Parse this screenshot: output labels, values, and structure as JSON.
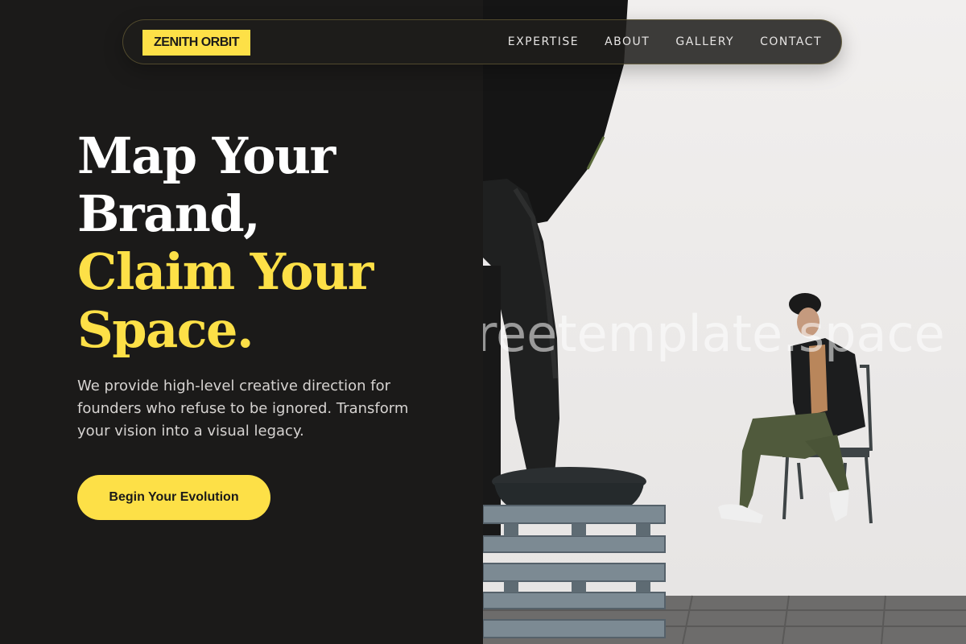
{
  "nav": {
    "logo": "ZENITH ORBIT",
    "links": [
      "EXPERTISE",
      "ABOUT",
      "GALLERY",
      "CONTACT"
    ]
  },
  "hero": {
    "headline_lines": [
      "Map Your",
      "Brand,",
      "Claim Your",
      "Space."
    ],
    "subtext": "We provide high-level creative direction for founders who refuse to be ignored. Transform your vision into a visual legacy.",
    "cta_label": "Begin Your Evolution"
  },
  "image": {
    "watermark": "freetemplate.space"
  },
  "colors": {
    "background": "#1b1a19",
    "accent": "#fde047",
    "text_light": "#ffffff",
    "text_muted": "#d6d3d1"
  }
}
